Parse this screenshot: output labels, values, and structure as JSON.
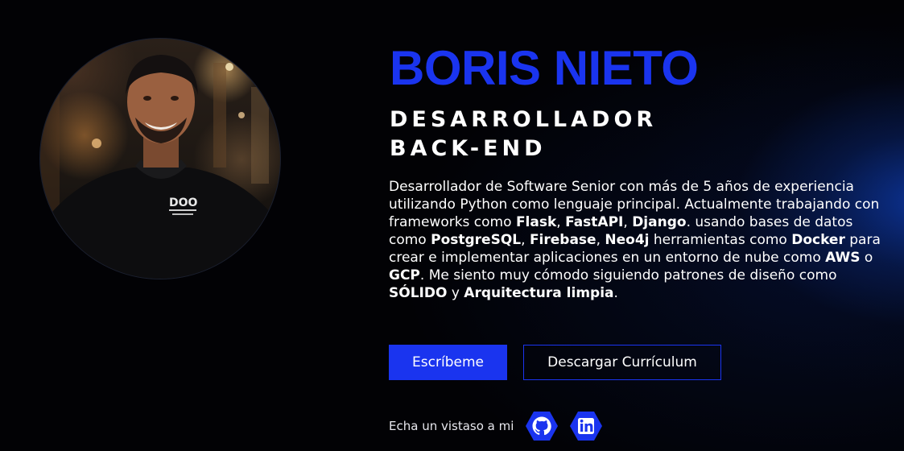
{
  "profile": {
    "name": "BORIS NIETO",
    "role_line1": "DESARROLLADOR",
    "role_line2": "BACK-END",
    "photo_alt": "Boris Nieto"
  },
  "bio": {
    "t1": "Desarrollador de Software Senior con más de 5 años de experiencia utilizando Python como lenguaje principal. Actualmente trabajando con frameworks como ",
    "flask": "Flask",
    "t2": ", ",
    "fastapi": "FastAPI",
    "t3": ", ",
    "django": "Django",
    "t4": ". usando bases de datos como ",
    "postgresql": "PostgreSQL",
    "t5": ", ",
    "firebase": "Firebase",
    "t6": ", ",
    "neo4j": "Neo4j",
    "t7": " herramientas como ",
    "docker": "Docker",
    "t8": " para crear e implementar aplicaciones en un entorno de nube como ",
    "aws": "AWS",
    "t9": " o ",
    "gcp": "GCP",
    "t10": ". Me siento muy cómodo siguiendo patrones de diseño como ",
    "solid": "SÓLIDO",
    "t11": " y ",
    "clean": "Arquitectura limpia",
    "t12": "."
  },
  "buttons": {
    "contact": "Escríbeme",
    "resume": "Descargar Currículum"
  },
  "social": {
    "label": "Echa un vistaso a mi",
    "github_icon": "github-icon",
    "linkedin_icon": "linkedin-icon"
  },
  "colors": {
    "accent": "#1a34ef",
    "background": "#020205",
    "text": "#ffffff"
  }
}
